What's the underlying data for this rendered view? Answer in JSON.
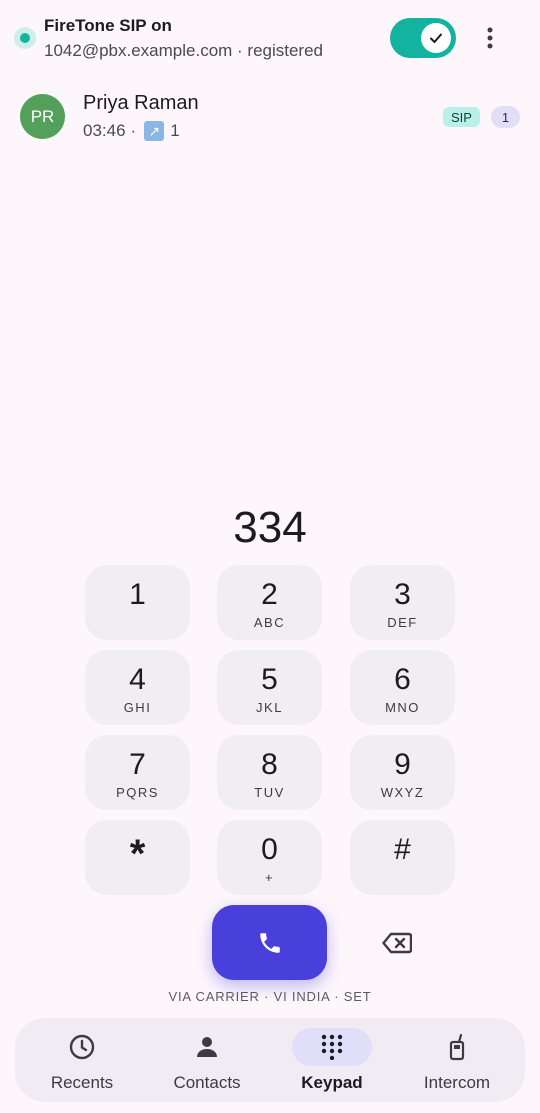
{
  "header": {
    "title": "FireTone SIP on",
    "subtitle": "1042@pbx.example.com · registered",
    "toggle_on": true,
    "status_color": "#14b3a0"
  },
  "active_call": {
    "initials": "PR",
    "name": "Priya Raman",
    "duration": "03:46",
    "separator": "·",
    "direction_icon": "outgoing-arrow-icon",
    "count": "1",
    "chip_label": "SIP",
    "badge_count": "1"
  },
  "dialer": {
    "number": "334",
    "keys": [
      {
        "digit": "1",
        "letters": ""
      },
      {
        "digit": "2",
        "letters": "ABC"
      },
      {
        "digit": "3",
        "letters": "DEF"
      },
      {
        "digit": "4",
        "letters": "GHI"
      },
      {
        "digit": "5",
        "letters": "JKL"
      },
      {
        "digit": "6",
        "letters": "MNO"
      },
      {
        "digit": "7",
        "letters": "PQRS"
      },
      {
        "digit": "8",
        "letters": "TUV"
      },
      {
        "digit": "9",
        "letters": "WXYZ"
      },
      {
        "digit": "*",
        "letters": ""
      },
      {
        "digit": "0",
        "letters": "+"
      },
      {
        "digit": "#",
        "letters": ""
      }
    ],
    "route_label": "VIA CARRIER · VI INDIA · SET",
    "call_color": "#4940dc"
  },
  "nav": {
    "items": [
      {
        "label": "Recents",
        "icon": "clock-icon",
        "active": false
      },
      {
        "label": "Contacts",
        "icon": "person-icon",
        "active": false
      },
      {
        "label": "Keypad",
        "icon": "dialpad-icon",
        "active": true
      },
      {
        "label": "Intercom",
        "icon": "intercom-icon",
        "active": false
      }
    ]
  }
}
